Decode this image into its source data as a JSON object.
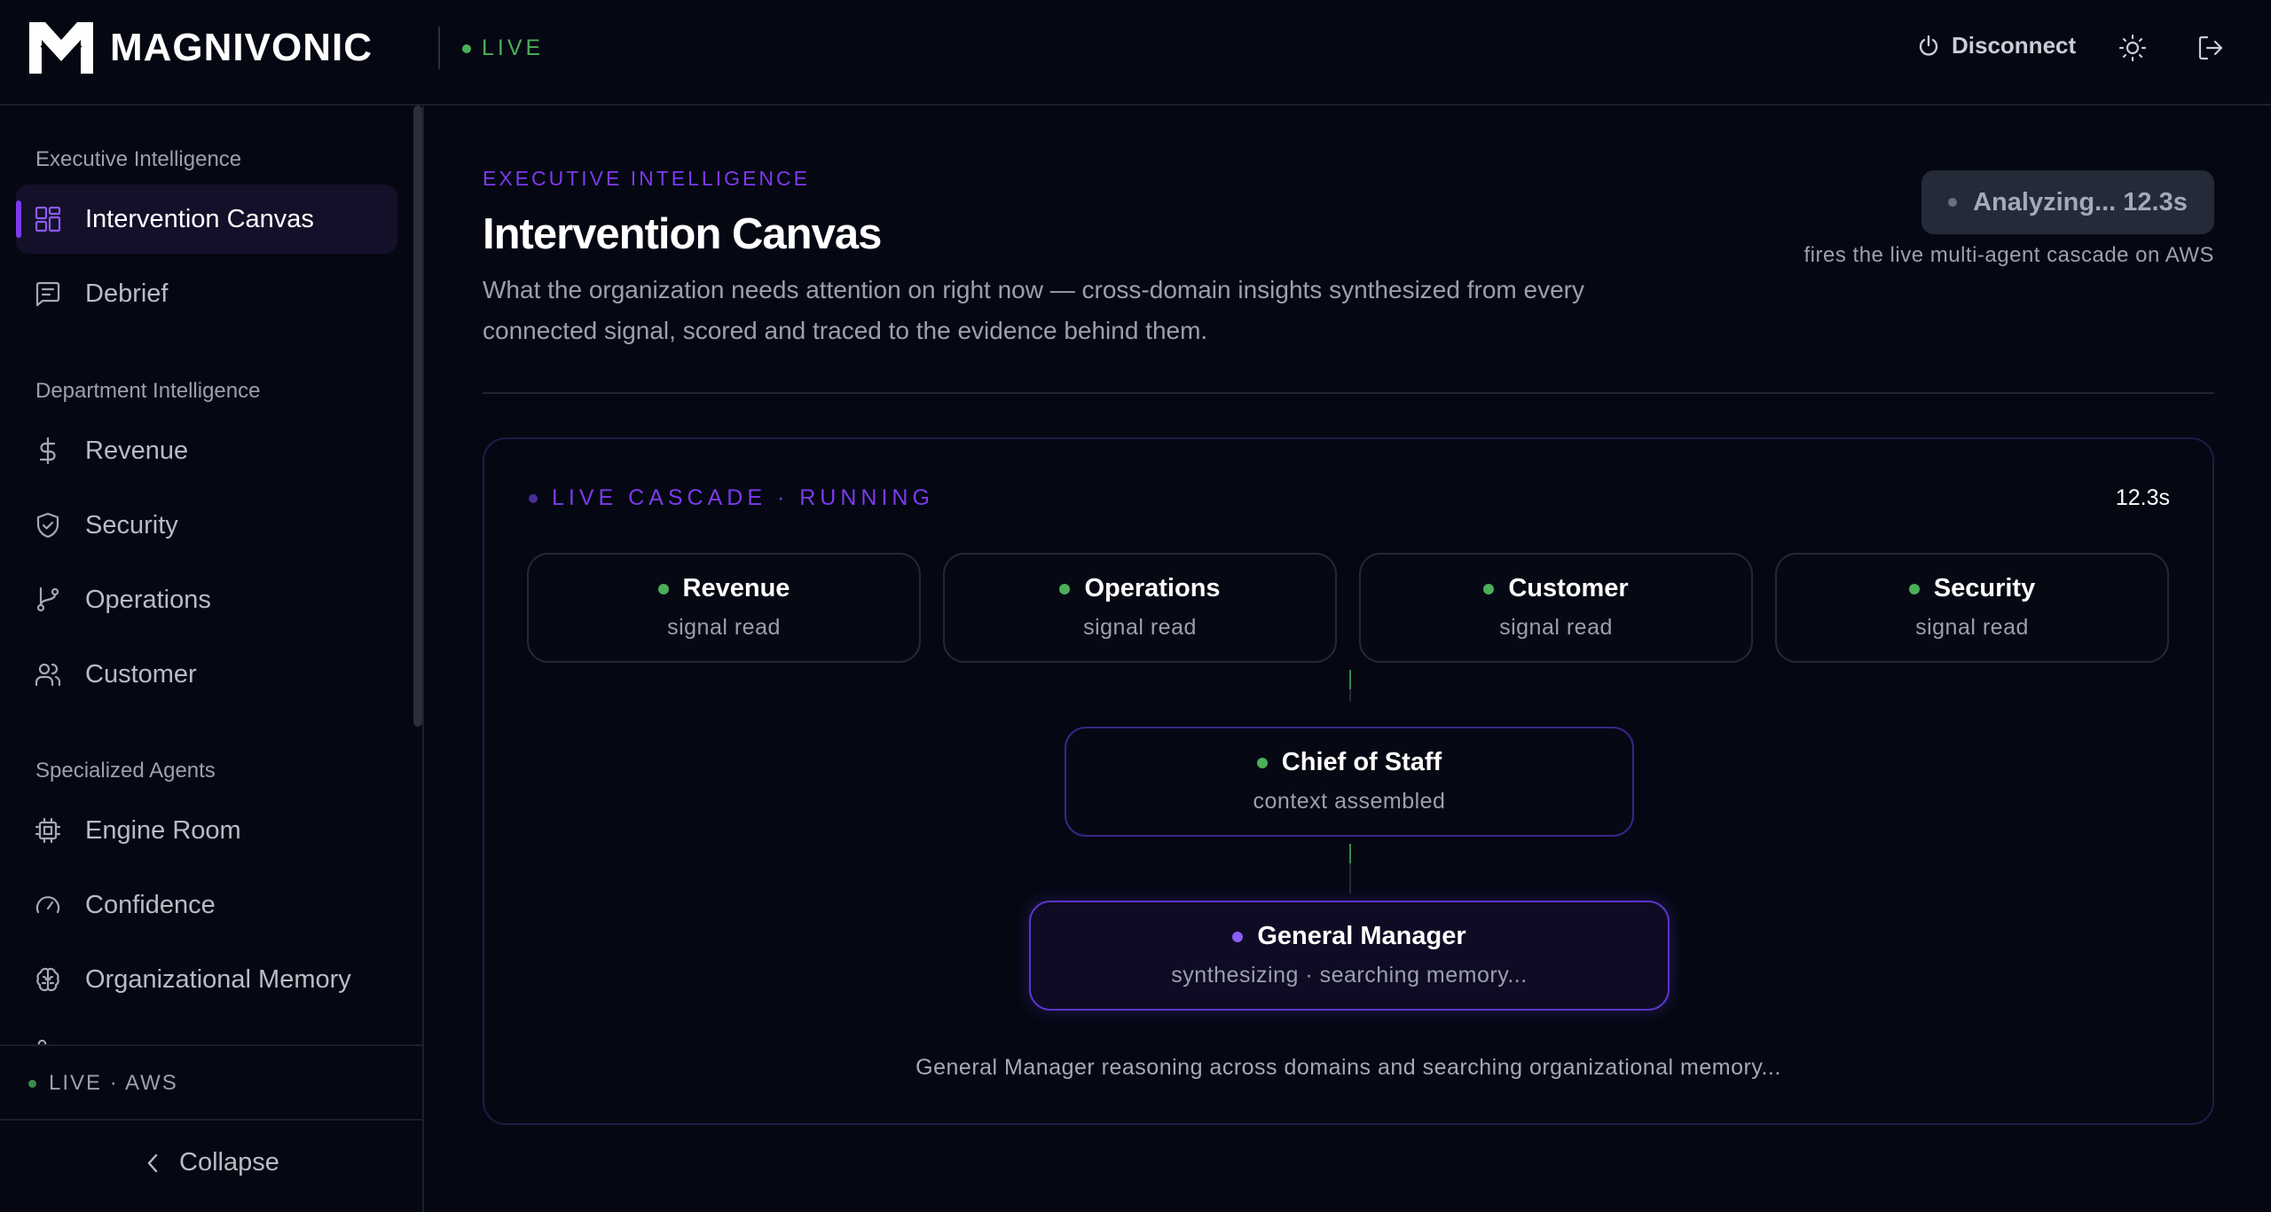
{
  "header": {
    "brand": "MAGNIVONIC",
    "live_label": "LIVE",
    "disconnect_label": "Disconnect"
  },
  "sidebar": {
    "sections": [
      {
        "label": "Executive Intelligence",
        "items": [
          {
            "label": "Intervention Canvas",
            "icon": "dashboard-grid-icon",
            "active": true
          },
          {
            "label": "Debrief",
            "icon": "message-square-icon"
          }
        ]
      },
      {
        "label": "Department Intelligence",
        "items": [
          {
            "label": "Revenue",
            "icon": "dollar-sign-icon"
          },
          {
            "label": "Security",
            "icon": "shield-check-icon"
          },
          {
            "label": "Operations",
            "icon": "git-branch-icon"
          },
          {
            "label": "Customer",
            "icon": "users-icon"
          }
        ]
      },
      {
        "label": "Specialized Agents",
        "items": [
          {
            "label": "Engine Room",
            "icon": "cpu-icon"
          },
          {
            "label": "Confidence",
            "icon": "gauge-icon"
          },
          {
            "label": "Organizational Memory",
            "icon": "brain-icon"
          }
        ]
      }
    ],
    "footer_live": "LIVE · AWS",
    "collapse_label": "Collapse"
  },
  "main": {
    "eyebrow": "EXECUTIVE INTELLIGENCE",
    "title": "Intervention Canvas",
    "description": "What the organization needs attention on right now — cross-domain insights synthesized from every connected signal, scored and traced to the evidence behind them.",
    "analyze_button": "Analyzing... 12.3s",
    "analyze_hint": "fires the live multi-agent cascade on AWS"
  },
  "cascade": {
    "header": "LIVE CASCADE · RUNNING",
    "elapsed": "12.3s",
    "departments": [
      {
        "name": "Revenue",
        "status": "signal read"
      },
      {
        "name": "Operations",
        "status": "signal read"
      },
      {
        "name": "Customer",
        "status": "signal read"
      },
      {
        "name": "Security",
        "status": "signal read"
      }
    ],
    "chief": {
      "name": "Chief of Staff",
      "status": "context assembled"
    },
    "gm": {
      "name": "General Manager",
      "status": "synthesizing · searching memory..."
    },
    "caption": "General Manager reasoning across domains and searching organizational memory...",
    "colors": {
      "done": "#4caf5a",
      "active": "#8b5cf6",
      "accent": "#7c3aed"
    }
  }
}
